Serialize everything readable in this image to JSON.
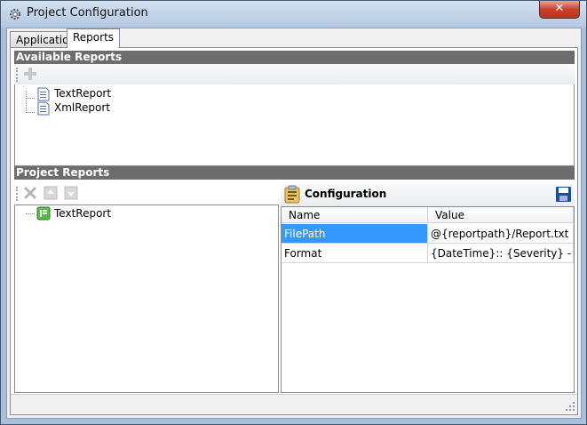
{
  "window": {
    "title": "Project Configuration",
    "close_label": "✕"
  },
  "tabs": [
    {
      "label": "Application",
      "active": false
    },
    {
      "label": "Reports",
      "active": true
    }
  ],
  "available_reports": {
    "header": "Available Reports",
    "items": [
      {
        "label": "TextReport",
        "icon": "document-report-icon"
      },
      {
        "label": "XmlReport",
        "icon": "document-report-icon"
      }
    ]
  },
  "project_reports": {
    "header": "Project Reports",
    "items": [
      {
        "label": "TextReport",
        "icon": "report-page-green-icon"
      }
    ]
  },
  "configuration": {
    "title": "Configuration",
    "columns": [
      "Name",
      "Value"
    ],
    "rows": [
      {
        "name": "FilePath",
        "value": "@{reportpath}/Report.txt",
        "selected": true
      },
      {
        "name": "Format",
        "value": "{DateTime}:: {Severity} - {Inde...",
        "selected": false
      }
    ]
  },
  "colors": {
    "section_header": "#6d6d6d",
    "selection": "#3399ff",
    "title_bar": "#b9cde4"
  }
}
